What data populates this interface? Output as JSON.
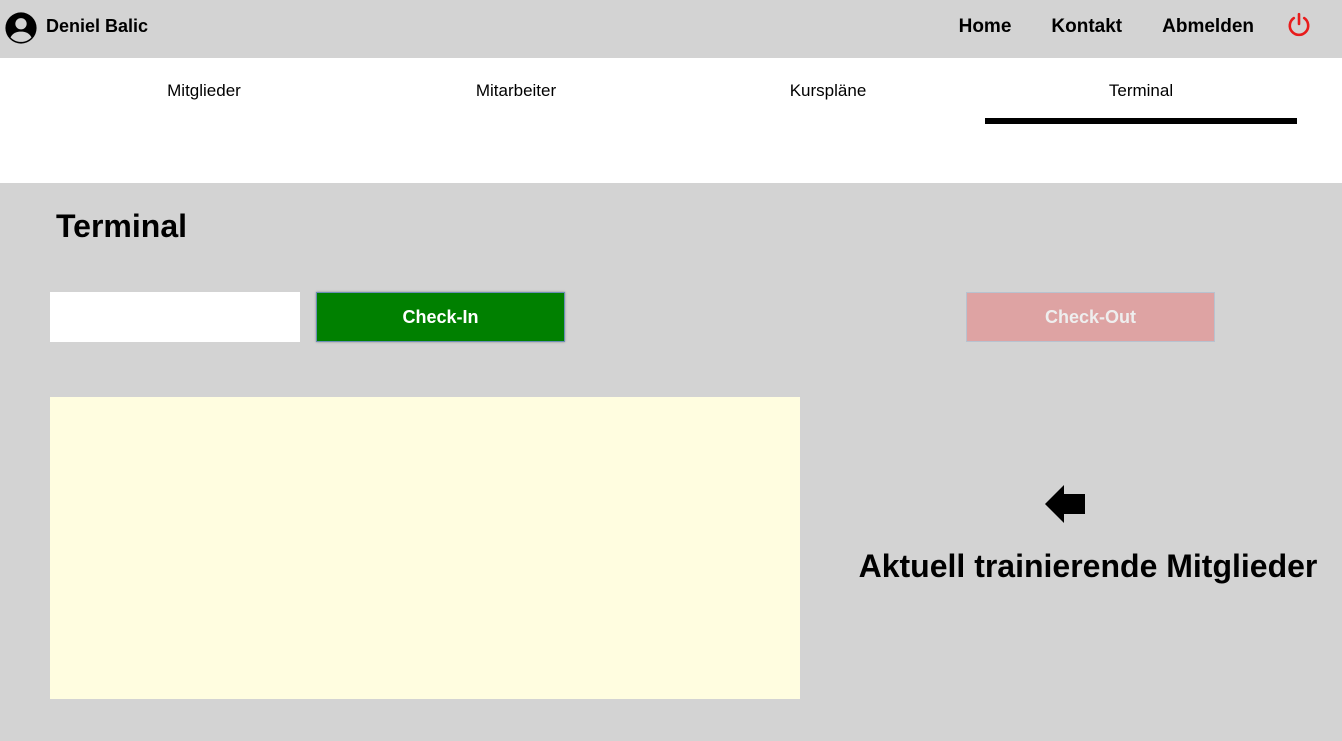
{
  "user": {
    "name": "Deniel Balic",
    "icon": "account-circle-icon"
  },
  "topnav": {
    "home": "Home",
    "kontakt": "Kontakt",
    "abmelden": "Abmelden",
    "power_icon": "power-icon",
    "power_color": "#e81c1c"
  },
  "tabs": [
    {
      "label": "Mitglieder",
      "active": false
    },
    {
      "label": "Mitarbeiter",
      "active": false
    },
    {
      "label": "Kurspläne",
      "active": false
    },
    {
      "label": "Terminal",
      "active": true
    }
  ],
  "main": {
    "title": "Terminal",
    "input": {
      "value": "",
      "placeholder": ""
    },
    "checkin_label": "Check-In",
    "checkout_label": "Check-Out",
    "members_label": "Aktuell trainierende Mitglieder",
    "arrow_icon": "arrow-left-icon"
  },
  "colors": {
    "background": "#d3d3d3",
    "checkin": "#008000",
    "checkout": "#dea3a3",
    "members_box": "#fffde0"
  }
}
